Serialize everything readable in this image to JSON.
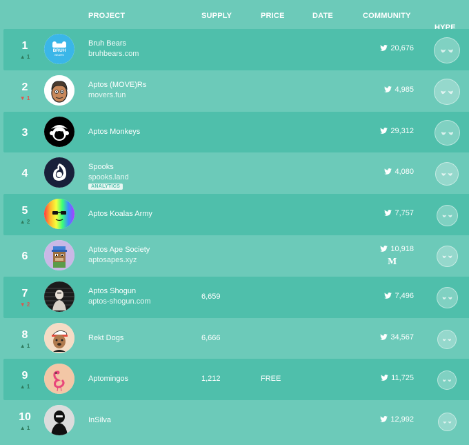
{
  "header": {
    "project": "PROJECT",
    "supply": "SUPPLY",
    "price": "PRICE",
    "date": "DATE",
    "community": "COMMUNITY",
    "hype": "HYPE",
    "hype_arrow": "↓"
  },
  "colors": {
    "background": "#6ccab9",
    "row_dark": "#4fbfab",
    "up": "#2f7a5d",
    "down": "#e0534a"
  },
  "rows": [
    {
      "rank": "1",
      "move": "▲ 1",
      "move_dir": "up",
      "name": "Bruh Bears",
      "url": "bruhbears.com",
      "badge": "",
      "supply": "",
      "price": "",
      "twitter": "20,676",
      "medium": "",
      "avatar": "bruh-bears-logo",
      "hype_level": 1.0
    },
    {
      "rank": "2",
      "move": "▼ 1",
      "move_dir": "down",
      "name": "Aptos (MOVE)Rs",
      "url": "movers.fun",
      "badge": "",
      "supply": "",
      "price": "",
      "twitter": "4,985",
      "medium": "",
      "avatar": "movers-avatar",
      "hype_level": 1.0
    },
    {
      "rank": "3",
      "move": "",
      "move_dir": "",
      "name": "Aptos Monkeys",
      "url": "",
      "badge": "",
      "supply": "",
      "price": "",
      "twitter": "29,312",
      "medium": "",
      "avatar": "monkey-avatar",
      "hype_level": 0.95
    },
    {
      "rank": "4",
      "move": "",
      "move_dir": "",
      "name": "Spooks",
      "url": "spooks.land",
      "badge": "ANALYTICS",
      "supply": "",
      "price": "",
      "twitter": "4,080",
      "medium": "",
      "avatar": "spooks-avatar",
      "hype_level": 0.8
    },
    {
      "rank": "5",
      "move": "▲ 2",
      "move_dir": "up",
      "name": "Aptos Koalas Army",
      "url": "",
      "badge": "",
      "supply": "",
      "price": "",
      "twitter": "7,757",
      "medium": "",
      "avatar": "koala-avatar",
      "hype_level": 0.6
    },
    {
      "rank": "6",
      "move": "",
      "move_dir": "",
      "name": "Aptos Ape Society",
      "url": "aptosapes.xyz",
      "badge": "",
      "supply": "",
      "price": "",
      "twitter": "10,918",
      "medium": "M",
      "avatar": "ape-avatar",
      "hype_level": 0.6
    },
    {
      "rank": "7",
      "move": "▼ 2",
      "move_dir": "down",
      "name": "Aptos Shogun",
      "url": "aptos-shogun.com",
      "badge": "",
      "supply": "6,659",
      "price": "",
      "twitter": "7,496",
      "medium": "",
      "avatar": "shogun-avatar",
      "hype_level": 0.6
    },
    {
      "rank": "8",
      "move": "▲ 1",
      "move_dir": "up",
      "name": "Rekt Dogs",
      "url": "",
      "badge": "",
      "supply": "6,666",
      "price": "",
      "twitter": "34,567",
      "medium": "",
      "avatar": "rekt-dog-avatar",
      "hype_level": 0.45
    },
    {
      "rank": "9",
      "move": "▲ 1",
      "move_dir": "up",
      "name": "Aptomingos",
      "url": "",
      "badge": "",
      "supply": "1,212",
      "price": "FREE",
      "twitter": "11,725",
      "medium": "",
      "avatar": "flamingo-avatar",
      "hype_level": 0.45
    },
    {
      "rank": "10",
      "move": "▲ 1",
      "move_dir": "up",
      "name": "InSilva",
      "url": "",
      "badge": "",
      "supply": "",
      "price": "",
      "twitter": "12,992",
      "medium": "",
      "avatar": "insilva-avatar",
      "hype_level": 0.4
    }
  ]
}
